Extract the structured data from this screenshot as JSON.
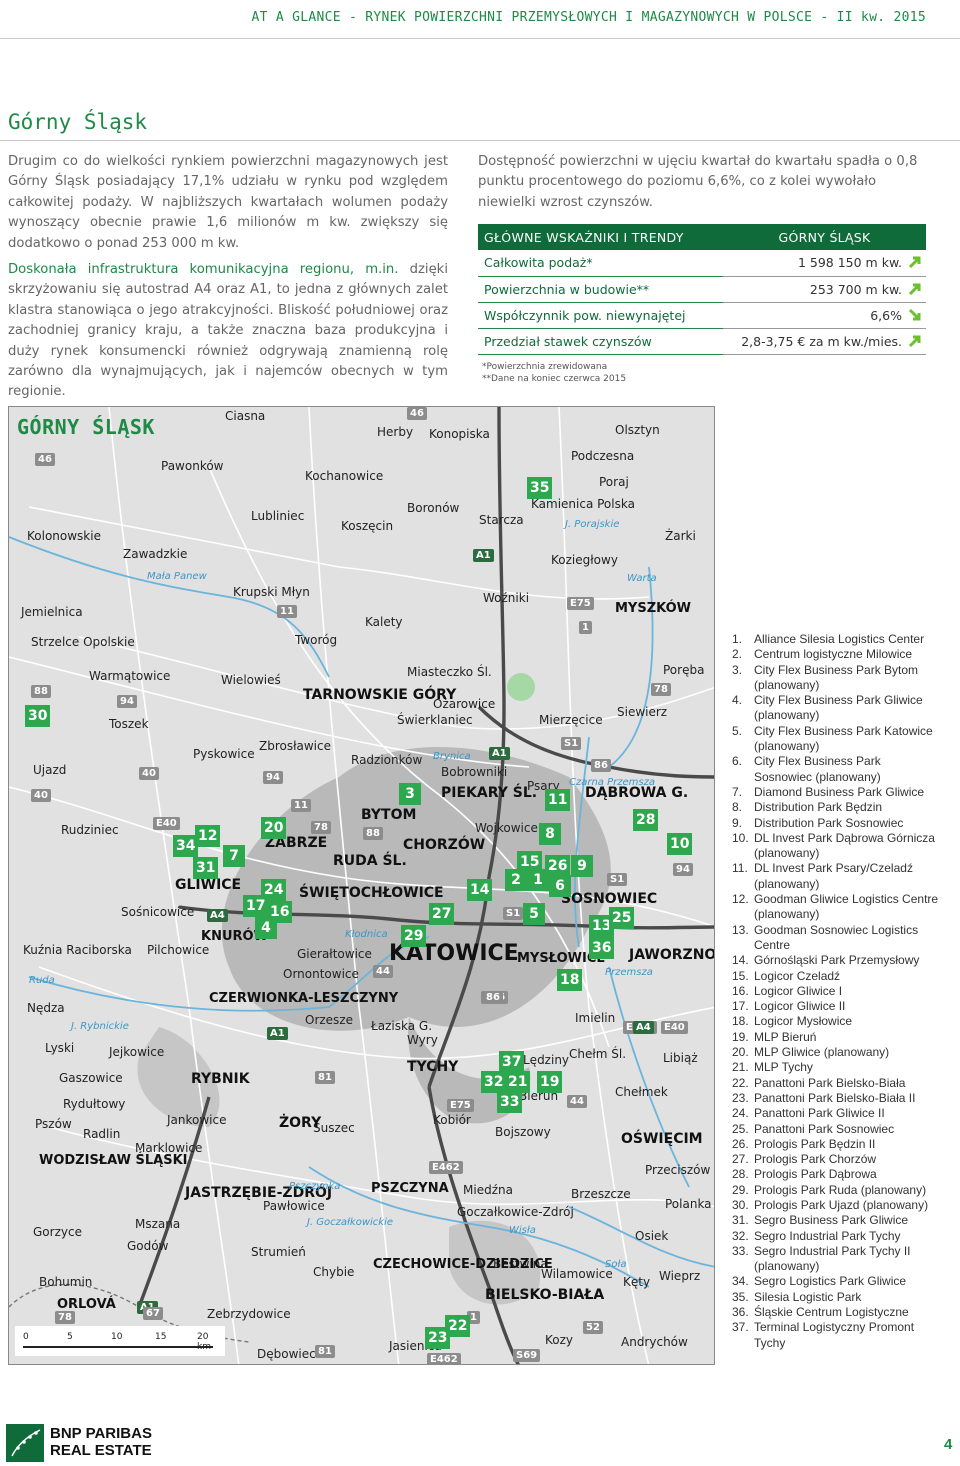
{
  "header": {
    "running_title": "AT A GLANCE - RYNEK POWIERZCHNI PRZEMYSŁOWYCH I MAGAZYNOWYCH W POLSCE - II kw. 2015"
  },
  "section": {
    "title": "Górny Śląsk"
  },
  "left_text": {
    "p1": "Drugim co do wielkości rynkiem powierzchni magazynowych jest Górny Śląsk posiadający 17,1% udziału w rynku pod względem całkowitej podaży. W najbliższych kwartałach wolumen podaży wynoszący obecnie prawie 1,6 milionów m kw. zwiększy się dodatkowo o ponad 253 000 m kw.",
    "p2_green": "Doskonała infrastruktura komunikacyjna regionu, m.in.",
    "p2_rest": " dzięki skrzyżowaniu się autostrad A4 oraz A1, to jedna z głównych zalet klastra stanowiąca o jego atrakcyjności. Bliskość południowej oraz zachodniej granicy kraju, a także znaczna baza produkcyjna i duży rynek konsumencki również odgrywają znamienną rolę zarówno dla wynajmujących, jak i najemców obecnych w tym regionie."
  },
  "right_text": "Dostępność powierzchni w ujęciu kwartał do kwartału spadła o 0,8 punktu procentowego do poziomu 6,6%, co z kolei wywołało niewielki wzrost czynszów.",
  "kpi": {
    "col1": "GŁÓWNE WSKAŹNIKI I TRENDY",
    "col2": "GÓRNY ŚLĄSK",
    "rows": [
      {
        "label": "Całkowita podaż*",
        "value": "1 598 150 m kw.",
        "trend": "up"
      },
      {
        "label": "Powierzchnia w budowie**",
        "value": "253 700 m kw.",
        "trend": "up"
      },
      {
        "label": "Współczynnik pow. niewynajętej",
        "value": "6,6%",
        "trend": "down"
      },
      {
        "label": "Przedział stawek czynszów",
        "value": "2,8-3,75 € za m kw./mies.",
        "trend": "up"
      }
    ],
    "footnote1": "*Powierzchnia zrewidowana",
    "footnote2": "**Dane na koniec czerwca 2015",
    "colors": {
      "header_bg": "#0f6b3a",
      "label": "#0f6b3a",
      "arrow": "#6cbf2e"
    }
  },
  "map": {
    "title": "GÓRNY ŚLĄSK",
    "marker_color": "#2ea84f",
    "places": [
      {
        "t": "Ciasna"
      },
      {
        "t": "Herby"
      },
      {
        "t": "Konopiska"
      },
      {
        "t": "Olsztyn"
      },
      {
        "t": "Podczesna"
      },
      {
        "t": "Pawonków"
      },
      {
        "t": "Kochanowice"
      },
      {
        "t": "Poraj"
      },
      {
        "t": "Kamienica Polska"
      },
      {
        "t": "Boronów"
      },
      {
        "t": "Lubliniec"
      },
      {
        "t": "Koszęcin"
      },
      {
        "t": "Starcza"
      },
      {
        "t": "Kolonowskie"
      },
      {
        "t": "Żarki"
      },
      {
        "t": "Zawadzkie"
      },
      {
        "t": "Koziegłowy"
      },
      {
        "t": "Krupski Młyn"
      },
      {
        "t": "Woźniki"
      },
      {
        "t": "Jemielnica"
      },
      {
        "t": "Kalety"
      },
      {
        "t": "Tworóg"
      },
      {
        "t": "Strzelce Opolskie"
      },
      {
        "t": "Warmątowice"
      },
      {
        "t": "Wielowieś"
      },
      {
        "t": "Miasteczko Śl."
      },
      {
        "t": "Poręba"
      },
      {
        "t": "Ożarowice"
      },
      {
        "t": "Siewierz"
      },
      {
        "t": "Toszek"
      },
      {
        "t": "Świerklaniec"
      },
      {
        "t": "Mierzęcice"
      },
      {
        "t": "Pyskowice"
      },
      {
        "t": "Zbrosławice"
      },
      {
        "t": "Radzionków"
      },
      {
        "t": "Ujazd"
      },
      {
        "t": "Bobrowniki"
      },
      {
        "t": "Psary"
      },
      {
        "t": "Wojkowice"
      },
      {
        "t": "Rudziniec"
      },
      {
        "t": "Sośnicowice"
      },
      {
        "t": "Pilchowice"
      },
      {
        "t": "Gierałtowice"
      },
      {
        "t": "Kuźnia Raciborska"
      },
      {
        "t": "Ornontowice"
      },
      {
        "t": "Nędza"
      },
      {
        "t": "Orzesze"
      },
      {
        "t": "Łaziska G."
      },
      {
        "t": "Wyry"
      },
      {
        "t": "Imielin"
      },
      {
        "t": "Chełm Śl."
      },
      {
        "t": "Lędziny"
      },
      {
        "t": "Lyski"
      },
      {
        "t": "Jejkowice"
      },
      {
        "t": "Libiąż"
      },
      {
        "t": "Gaszowice"
      },
      {
        "t": "Bieruń"
      },
      {
        "t": "Chełmek"
      },
      {
        "t": "Rydułtowy"
      },
      {
        "t": "Suszec"
      },
      {
        "t": "Kobiór"
      },
      {
        "t": "Jankowice"
      },
      {
        "t": "Pszów"
      },
      {
        "t": "Radlin"
      },
      {
        "t": "Bojszowy"
      },
      {
        "t": "Marklowice"
      },
      {
        "t": "Przeciszów"
      },
      {
        "t": "Miedźna"
      },
      {
        "t": "Brzeszcze"
      },
      {
        "t": "Pawłowice"
      },
      {
        "t": "Polanka Wielka"
      },
      {
        "t": "Goczałkowice-Zdrój"
      },
      {
        "t": "Mszana"
      },
      {
        "t": "Gorzyce"
      },
      {
        "t": "Osiek"
      },
      {
        "t": "Godów"
      },
      {
        "t": "Strumień"
      },
      {
        "t": "Bestwina"
      },
      {
        "t": "Wilamowice"
      },
      {
        "t": "Chybie"
      },
      {
        "t": "Kęty"
      },
      {
        "t": "Wieprz"
      },
      {
        "t": "Bohumin"
      },
      {
        "t": "Zebrzydowice"
      },
      {
        "t": "Jasienica"
      },
      {
        "t": "Kozy"
      },
      {
        "t": "Andrychów"
      },
      {
        "t": "Dębowiec"
      }
    ],
    "cities": [
      "MYSZKÓW",
      "TARNOWSKIE GÓRY",
      "PIEKARY ŚL.",
      "DĄBROWA G.",
      "BYTOM",
      "CHORZÓW",
      "ZABRZE",
      "RUDA ŚL.",
      "GLIWICE",
      "ŚWIĘTOCHŁOWICE",
      "SOSNOWIEC",
      "KNURÓW",
      "KATOWICE",
      "MYSŁOWICE",
      "JAWORZNO",
      "CZERWIONKA-LESZCZYNY",
      "RYBNIK",
      "TYCHY",
      "ŻORY",
      "WODZISŁAW ŚLĄSKI",
      "OŚWIĘCIM",
      "JASTRZĘBIE-ZDRÓJ",
      "PSZCZYNA",
      "CZECHOWICE-DZIEDZICE",
      "BIELSKO-BIAŁA",
      "ORLOVÁ"
    ],
    "waters": [
      "Mała Panew",
      "Warta",
      "J. Porajskie",
      "Kłodnica",
      "Ruda",
      "J. Rybnickie",
      "Pszczynka",
      "J. Goczałkowickie",
      "Wisła",
      "Soła",
      "Przemsza",
      "Czarna Przemsza",
      "Brynica"
    ],
    "roads": [
      "46",
      "46",
      "A1",
      "E75",
      "11",
      "1",
      "88",
      "94",
      "78",
      "40",
      "S1",
      "40",
      "E40",
      "11",
      "78",
      "88",
      "94",
      "A4",
      "S1",
      "86",
      "S86",
      "S1",
      "A1",
      "E40",
      "E462",
      "81",
      "E75",
      "A1",
      "78",
      "67",
      "81",
      "52",
      "E462",
      "S69",
      "1",
      "44",
      "94",
      "86",
      "44",
      "E462",
      "A4",
      "A1"
    ],
    "markers": [
      "35",
      "3",
      "11",
      "8",
      "28",
      "10",
      "12",
      "34",
      "20",
      "31",
      "7",
      "15",
      "26",
      "9",
      "2",
      "1",
      "6",
      "24",
      "14",
      "17",
      "16",
      "4",
      "27",
      "5",
      "13",
      "25",
      "29",
      "36",
      "18",
      "37",
      "32",
      "21",
      "19",
      "33",
      "22",
      "23",
      "30"
    ],
    "scale": [
      "0",
      "5",
      "10",
      "15",
      "20 km"
    ]
  },
  "legend": [
    "Alliance Silesia Logistics Center",
    "Centrum logistyczne Milowice",
    "City Flex Business Park Bytom (planowany)",
    "City Flex Business Park Gliwice (planowany)",
    "City Flex Business Park Katowice (planowany)",
    "City Flex Business Park Sosnowiec (planowany)",
    "Diamond Business Park Gliwice",
    "Distribution Park Będzin",
    "Distribution Park Sosnowiec",
    "DL Invest Park Dąbrowa Górnicza (planowany)",
    "DL Invest Park Psary/Czeladź (planowany)",
    "Goodman Gliwice Logistics Centre (planowany)",
    "Goodman Sosnowiec Logistics Centre",
    "Górnośląski Park Przemysłowy",
    "Logicor Czeladź",
    "Logicor Gliwice I",
    "Logicor Gliwice II",
    "Logicor Mysłowice",
    "MLP Bieruń",
    "MLP Gliwice (planowany)",
    "MLP Tychy",
    "Panattoni Park Bielsko-Biała",
    "Panattoni Park Bielsko-Biała II",
    "Panattoni Park Gliwice II",
    "Panattoni Park Sosnowiec",
    "Prologis Park Będzin II",
    "Prologis Park Chorzów",
    "Prologis Park Dąbrowa",
    "Prologis Park Ruda (planowany)",
    "Prologis Park Ujazd (planowany)",
    "Segro Business Park Gliwice",
    "Segro Industrial Park Tychy",
    "Segro Industrial Park Tychy II (planowany)",
    "Segro Logistics Park Gliwice",
    "Silesia Logistic Park",
    "Śląskie Centrum Logistyczne",
    "Terminal Logistyczny Promont Tychy"
  ],
  "footer": {
    "brand_line1": "BNP PARIBAS",
    "brand_line2": "REAL ESTATE",
    "page": "4"
  }
}
